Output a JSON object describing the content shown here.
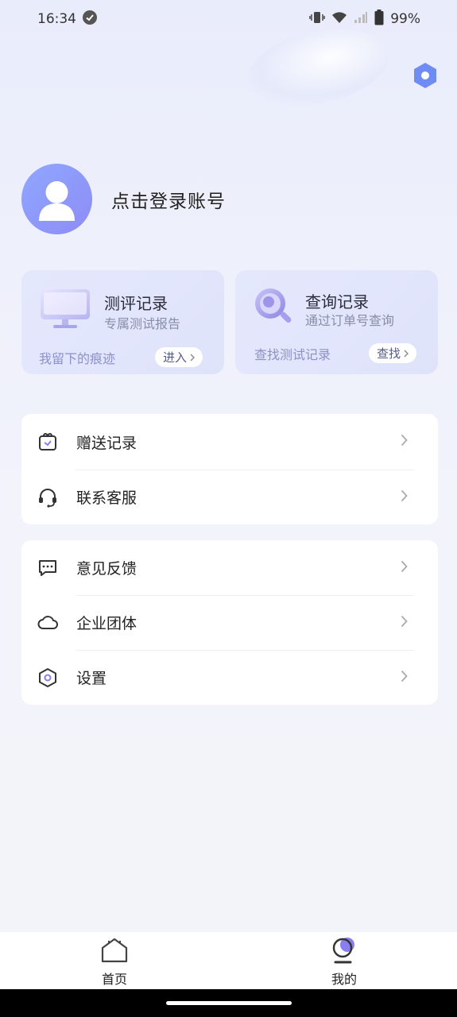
{
  "status_bar": {
    "time": "16:34",
    "battery": "99%"
  },
  "profile": {
    "login_text": "点击登录账号"
  },
  "cards": [
    {
      "title": "测评记录",
      "subtitle": "专属测试报告",
      "footer": "我留下的痕迹",
      "button": "进入"
    },
    {
      "title": "查询记录",
      "subtitle": "通过订单号查询",
      "footer": "查找测试记录",
      "button": "查找"
    }
  ],
  "menu_group1": [
    {
      "label": "赠送记录",
      "icon": "gift-icon"
    },
    {
      "label": "联系客服",
      "icon": "headset-icon"
    }
  ],
  "menu_group2": [
    {
      "label": "意见反馈",
      "icon": "chat-icon"
    },
    {
      "label": "企业团体",
      "icon": "cloud-icon"
    },
    {
      "label": "设置",
      "icon": "settings-icon"
    }
  ],
  "tabbar": {
    "home_label": "首页",
    "mine_label": "我的"
  },
  "colors": {
    "accent": "#7b86f0",
    "card_bg": "#e3e6fc"
  }
}
